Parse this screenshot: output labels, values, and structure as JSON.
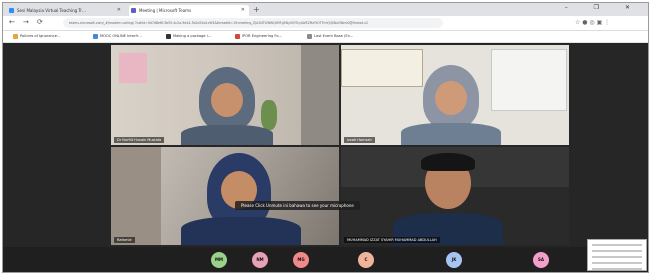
{
  "browser": {
    "tabs": [
      {
        "label": "Sesi Malaysia Virtual Teaching Tr…",
        "favicon_color": "#2d8cff"
      },
      {
        "label": "Meeting | Microsoft Teams",
        "favicon_color": "#5b5fc7",
        "active": true
      }
    ],
    "new_tab_label": "+",
    "window_controls": "– ❐ ✕",
    "nav": {
      "back": "←",
      "forward": "→",
      "reload": "⟳"
    },
    "url": "teams.microsoft.com/_#/modern-calling/ ?callId=9d7d8e6f-3b55-4c2a-9d44-3b2d34a1c9f4&threadId=19:meeting_ZjA1NTI0NWQtMTg5Ny00YTcyLWE2MzYtOTFmYjQ0NzI3NmI0@thread.v2",
    "bookmarks": [
      {
        "label": "Policies of Ignorance…",
        "icon_color": "#e8a33d"
      },
      {
        "label": "MOOC ONLINE Interfr…",
        "icon_color": "#3f8bd8"
      },
      {
        "label": "Making a package i…",
        "icon_color": "#333333"
      },
      {
        "label": "IPOR Engineering Fo…",
        "icon_color": "#d04a3c"
      },
      {
        "label": "Last Event Base (En…",
        "icon_color": "#8a8a8a"
      }
    ]
  },
  "meeting": {
    "tiles": [
      {
        "name": "Dr Nurfiit Husain Mustafa"
      },
      {
        "name": "Izzati Hamzah"
      },
      {
        "name": "Rafarnie"
      },
      {
        "name": "MUHAMMAD IZZAT SYAHIR MUHAMMAD ABDULLAH"
      }
    ],
    "toast": "Please Click Unmute ini bahawa to see your microphone",
    "participants": [
      {
        "initials": "MM",
        "color": "#9bd08a"
      },
      {
        "initials": "NM",
        "color": "#e7a0b4"
      },
      {
        "initials": "MG",
        "color": "#f08a8a"
      },
      {
        "initials": "C",
        "color": "#f0b49a"
      },
      {
        "initials": "JK",
        "color": "#a7c4f2"
      },
      {
        "initials": "SA",
        "color": "#f2a0c8"
      }
    ]
  }
}
